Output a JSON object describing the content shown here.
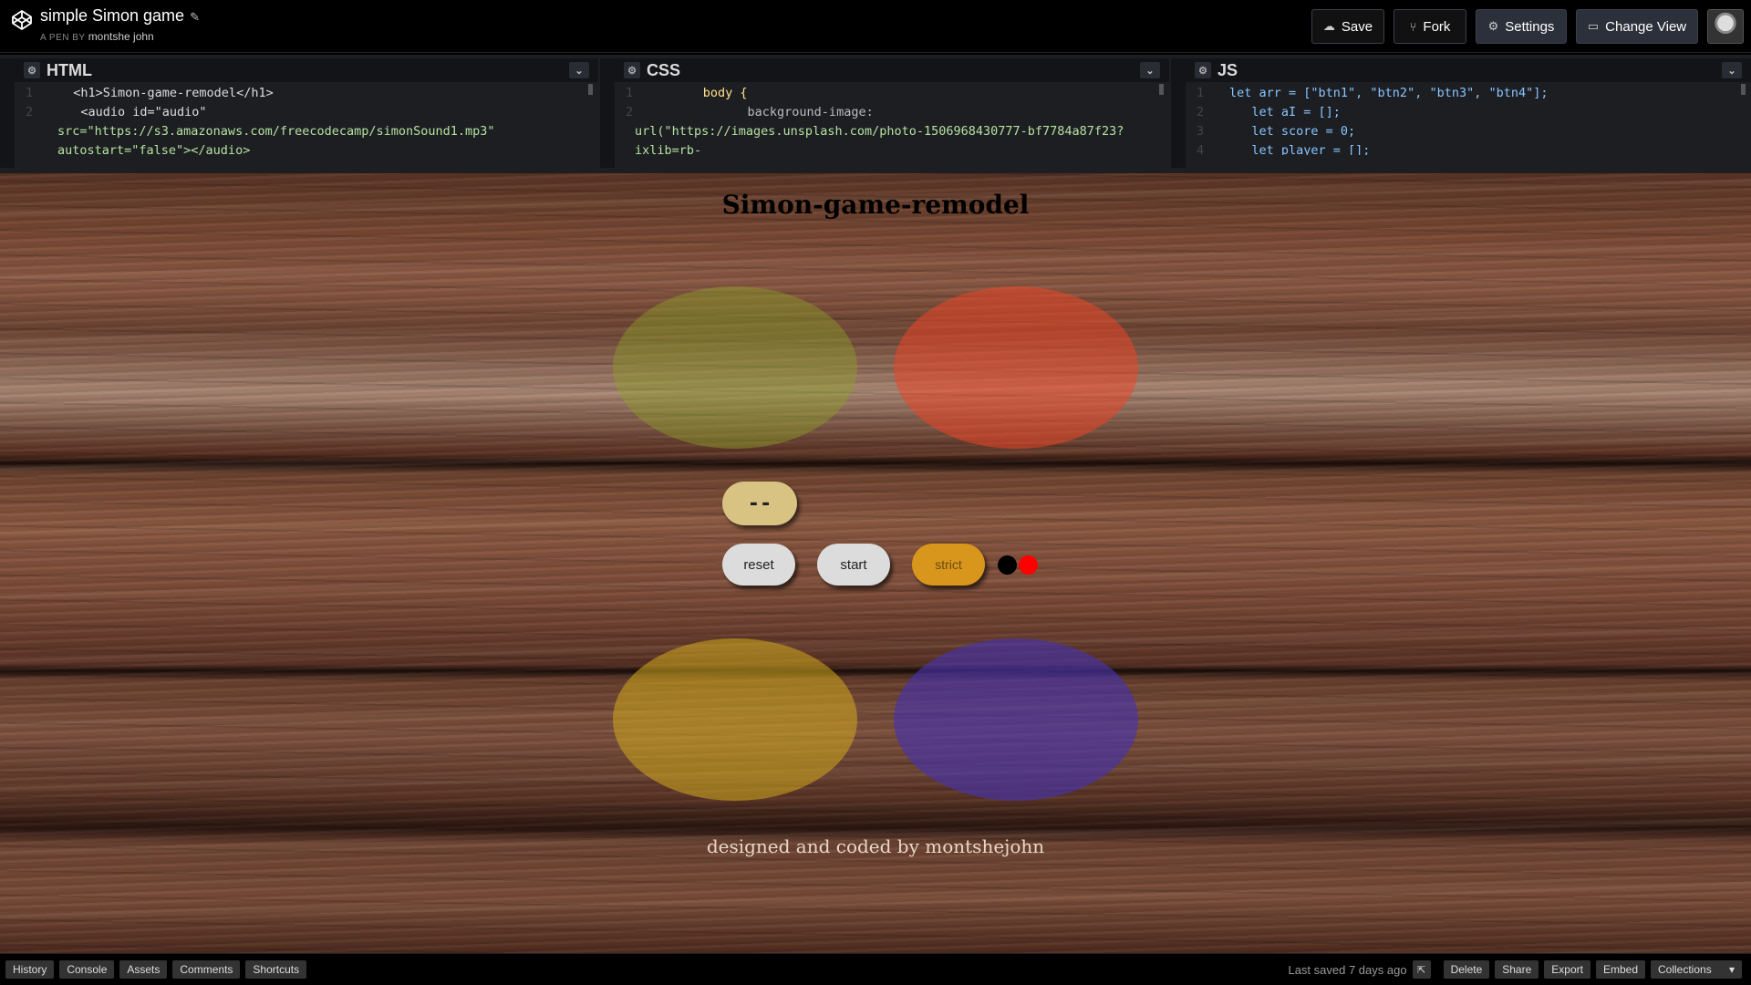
{
  "header": {
    "title": "simple Simon game",
    "author_prefix": "A PEN BY",
    "author": "montshe john",
    "buttons": {
      "save": "Save",
      "fork": "Fork",
      "settings": "Settings",
      "change_view": "Change View"
    }
  },
  "editors": {
    "html": {
      "label": "HTML",
      "lines": [
        {
          "n": "1",
          "code": "  <h1>Simon-game-remodel</h1>"
        },
        {
          "n": "2",
          "code": "   <audio id=\"audio\""
        },
        {
          "n": "",
          "code": "src=\"https://s3.amazonaws.com/freecodecamp/simonSound1.mp3\""
        },
        {
          "n": "",
          "code": "autostart=\"false\"></audio>"
        }
      ]
    },
    "css": {
      "label": "CSS",
      "lines": [
        {
          "n": "1",
          "code": "      body {"
        },
        {
          "n": "2",
          "code": "            background-image:"
        },
        {
          "n": "",
          "code": "url(\"https://images.unsplash.com/photo-1506968430777-bf7784a87f23?"
        },
        {
          "n": "",
          "code": "ixlib=rb-"
        }
      ]
    },
    "js": {
      "label": "JS",
      "lines": [
        {
          "n": "1",
          "code": "let arr = [\"btn1\", \"btn2\", \"btn3\", \"btn4\"];"
        },
        {
          "n": "2",
          "code": "   let aI = [];"
        },
        {
          "n": "3",
          "code": "   let score = 0;"
        },
        {
          "n": "4",
          "code": "   let player = [];"
        }
      ]
    }
  },
  "preview": {
    "heading": "Simon-game-remodel",
    "counter": "--",
    "buttons": {
      "reset": "reset",
      "start": "start",
      "strict": "strict"
    },
    "credit": "designed and coded by montshejohn",
    "pad_colors": {
      "green": "#8ca028",
      "red": "#eb4628",
      "yellow": "#d2aa1e",
      "blue": "#4632aa"
    },
    "strict_indicator_colors": [
      "#000000",
      "#ff0000"
    ]
  },
  "footer": {
    "left": [
      "History",
      "Console",
      "Assets",
      "Comments",
      "Shortcuts"
    ],
    "saved": "Last saved 7 days ago",
    "right": [
      "Delete",
      "Share",
      "Export",
      "Embed"
    ],
    "collections": "Collections"
  }
}
